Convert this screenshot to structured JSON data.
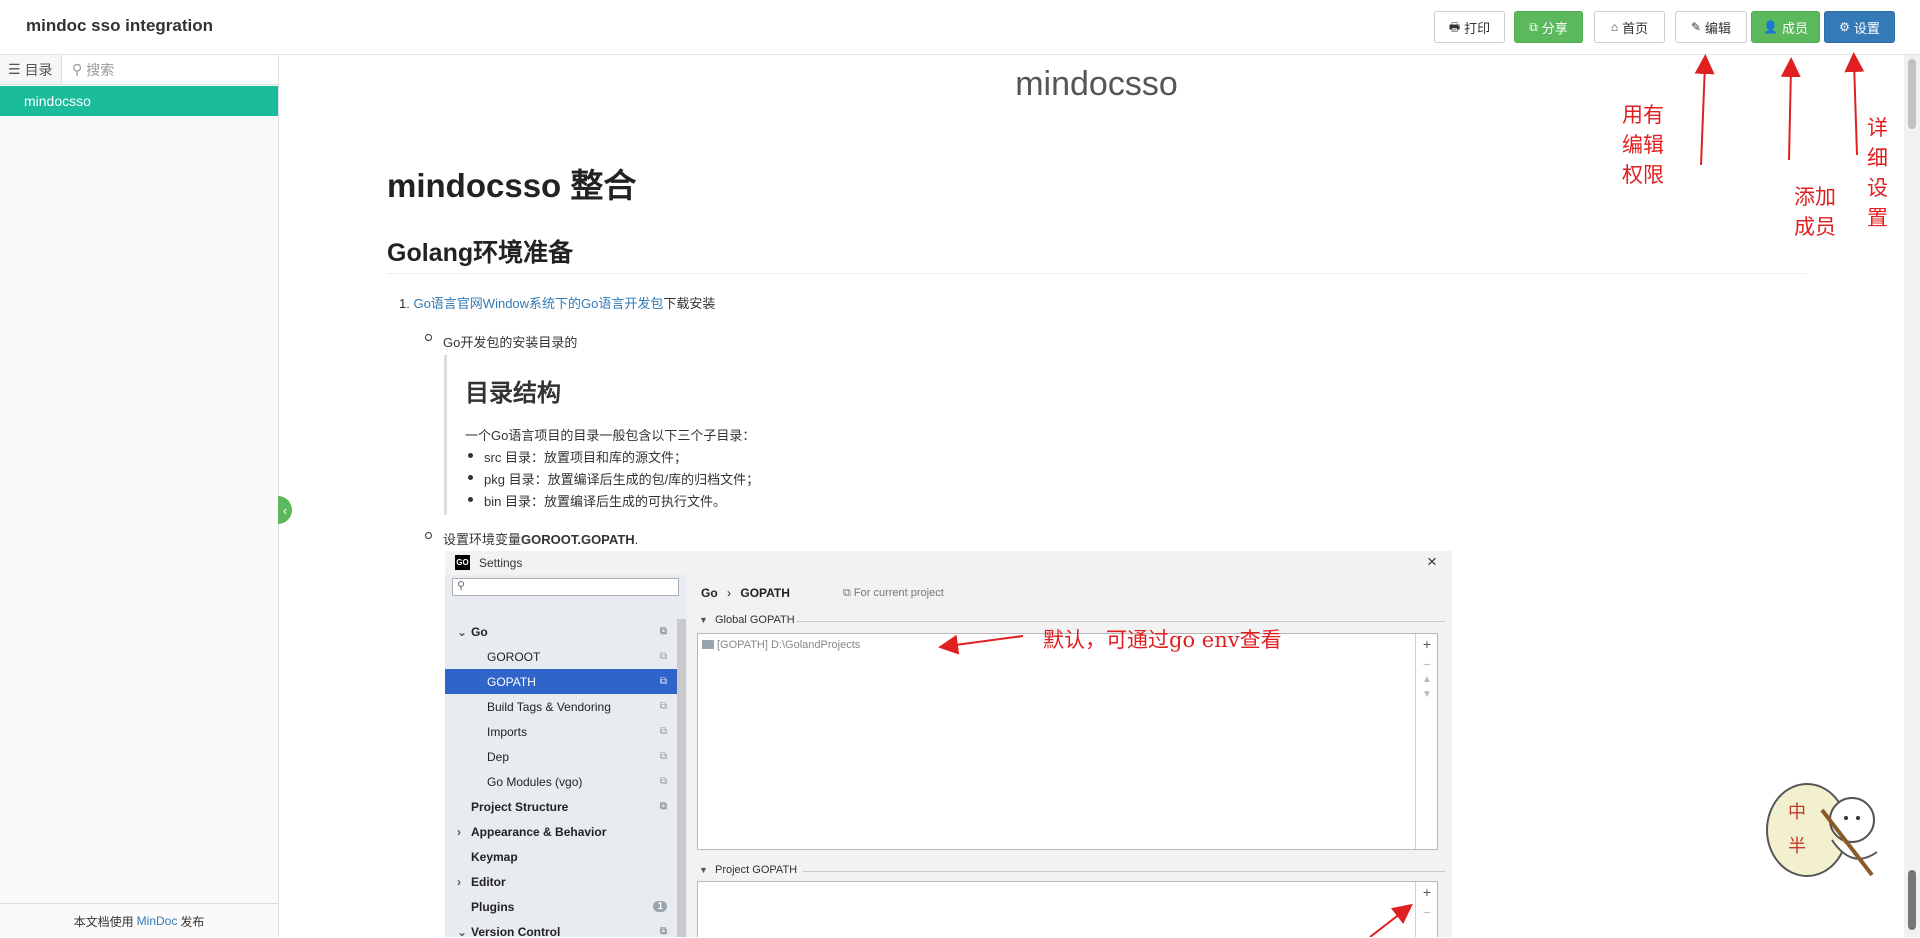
{
  "app": {
    "title": "mindoc sso integration"
  },
  "toolbar": {
    "print": "打印",
    "share": "分享",
    "home": "首页",
    "edit": "编辑",
    "members": "成员",
    "settings": "设置"
  },
  "sidebar": {
    "toc_tab": "目录",
    "search_placeholder": "搜索",
    "items": [
      {
        "label": "mindocsso",
        "active": true
      }
    ],
    "footer_prefix": "本文档使用",
    "footer_link": "MinDoc",
    "footer_suffix": "发布"
  },
  "doc": {
    "title": "mindocsso",
    "h1": "mindocsso 整合",
    "h2": "Golang环境准备",
    "item1_num": "1.",
    "item1_link": "Go语言官网Window系统下的Go语言开发包",
    "item1_text": "下载安装",
    "sub1": "Go开发包的安装目录的",
    "quote_heading": "目录结构",
    "quote_intro": "一个Go语言项目的目录一般包含以下三个子目录：",
    "quote_items": [
      "src 目录：放置项目和库的源文件；",
      "pkg 目录：放置编译后生成的包/库的归档文件；",
      "bin 目录：放置编译后生成的可执行文件。"
    ],
    "sub2_prefix": "设置环境变量",
    "sub2_bold": "GOROOT.GOPATH",
    "sub2_suffix": "."
  },
  "settings_screenshot": {
    "window_title": "Settings",
    "breadcrumb_root": "Go",
    "breadcrumb_sep": "›",
    "breadcrumb_leaf": "GOPATH",
    "scope": "For current project",
    "tree": [
      {
        "label": "Go",
        "bold": true,
        "expanded": true
      },
      {
        "label": "GOROOT"
      },
      {
        "label": "GOPATH",
        "selected": true
      },
      {
        "label": "Build Tags & Vendoring"
      },
      {
        "label": "Imports"
      },
      {
        "label": "Dep"
      },
      {
        "label": "Go Modules (vgo)"
      },
      {
        "label": "Project Structure",
        "bold": true
      },
      {
        "label": "Appearance & Behavior",
        "bold": true
      },
      {
        "label": "Keymap",
        "bold": true
      },
      {
        "label": "Editor",
        "bold": true
      },
      {
        "label": "Plugins",
        "bold": true,
        "badge": "1"
      },
      {
        "label": "Version Control",
        "bold": true
      }
    ],
    "global_section": "Global GOPATH",
    "global_entry": "[GOPATH] D:\\GolandProjects",
    "project_section": "Project GOPATH"
  },
  "annotations": {
    "edit_note": [
      "用有",
      "编辑",
      "权限"
    ],
    "member_note": [
      "添加",
      "成员"
    ],
    "settings_note": [
      "详",
      "细",
      "设",
      "置"
    ],
    "gopath_note": "默认，可通过go  env查看"
  },
  "colors": {
    "accent_green": "#5cb85c",
    "primary_blue": "#337ab7",
    "sidebar_active": "#1abc9c",
    "annotation_red": "#e02020"
  }
}
